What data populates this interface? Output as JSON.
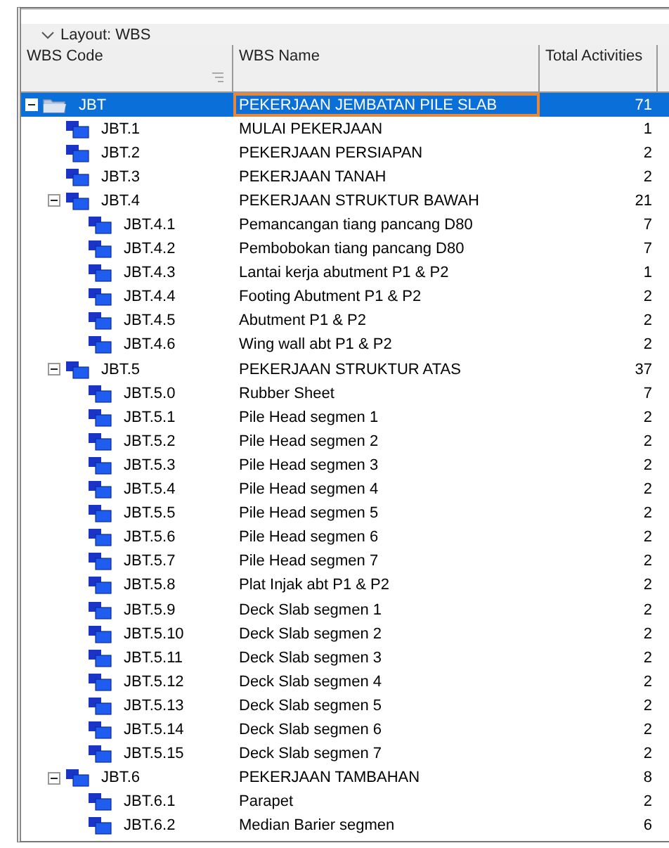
{
  "layout_bar": {
    "title": "Layout: WBS"
  },
  "table": {
    "columns": [
      "WBS Code",
      "WBS Name",
      "Total Activities"
    ],
    "rows": [
      {
        "code": "JBT",
        "name": "PEKERJAAN JEMBATAN PILE SLAB",
        "total": "71",
        "selected": true,
        "expanded": true,
        "children": [
          {
            "code": "JBT.1",
            "name": "MULAI PEKERJAAN",
            "total": "1",
            "selected": false
          },
          {
            "code": "JBT.2",
            "name": "PEKERJAAN PERSIAPAN",
            "total": "2",
            "selected": false
          },
          {
            "code": "JBT.3",
            "name": "PEKERJAAN TANAH",
            "total": "2",
            "selected": false
          },
          {
            "code": "JBT.4",
            "name": "PEKERJAAN STRUKTUR BAWAH",
            "total": "21",
            "selected": false,
            "expanded": true,
            "children": [
              {
                "code": "JBT.4.1",
                "name": "Pemancangan tiang pancang D80",
                "total": "7",
                "selected": false
              },
              {
                "code": "JBT.4.2",
                "name": "Pembobokan tiang pancang D80",
                "total": "7",
                "selected": false
              },
              {
                "code": "JBT.4.3",
                "name": "Lantai kerja abutment P1 & P2",
                "total": "1",
                "selected": false
              },
              {
                "code": "JBT.4.4",
                "name": "Footing Abutment P1 & P2",
                "total": "2",
                "selected": false
              },
              {
                "code": "JBT.4.5",
                "name": "Abutment P1 & P2",
                "total": "2",
                "selected": false
              },
              {
                "code": "JBT.4.6",
                "name": "Wing wall abt P1 & P2",
                "total": "2",
                "selected": false
              }
            ]
          },
          {
            "code": "JBT.5",
            "name": "PEKERJAAN STRUKTUR ATAS",
            "total": "37",
            "selected": false,
            "expanded": true,
            "children": [
              {
                "code": "JBT.5.0",
                "name": "Rubber Sheet",
                "total": "7",
                "selected": false
              },
              {
                "code": "JBT.5.1",
                "name": "Pile Head segmen 1",
                "total": "2",
                "selected": false
              },
              {
                "code": "JBT.5.2",
                "name": "Pile Head segmen 2",
                "total": "2",
                "selected": false
              },
              {
                "code": "JBT.5.3",
                "name": "Pile Head segmen 3",
                "total": "2",
                "selected": false
              },
              {
                "code": "JBT.5.4",
                "name": "Pile Head segmen 4",
                "total": "2",
                "selected": false
              },
              {
                "code": "JBT.5.5",
                "name": "Pile Head segmen 5",
                "total": "2",
                "selected": false
              },
              {
                "code": "JBT.5.6",
                "name": "Pile Head segmen 6",
                "total": "2",
                "selected": false
              },
              {
                "code": "JBT.5.7",
                "name": "Pile Head segmen 7",
                "total": "2",
                "selected": false
              },
              {
                "code": "JBT.5.8",
                "name": "Plat Injak abt P1 & P2",
                "total": "2",
                "selected": false
              },
              {
                "code": "JBT.5.9",
                "name": "Deck Slab segmen 1",
                "total": "2",
                "selected": false
              },
              {
                "code": "JBT.5.10",
                "name": "Deck Slab segmen 2",
                "total": "2",
                "selected": false
              },
              {
                "code": "JBT.5.11",
                "name": "Deck Slab segmen 3",
                "total": "2",
                "selected": false
              },
              {
                "code": "JBT.5.12",
                "name": "Deck Slab segmen 4",
                "total": "2",
                "selected": false
              },
              {
                "code": "JBT.5.13",
                "name": "Deck Slab segmen 5",
                "total": "2",
                "selected": false
              },
              {
                "code": "JBT.5.14",
                "name": "Deck Slab segmen 6",
                "total": "2",
                "selected": false
              },
              {
                "code": "JBT.5.15",
                "name": "Deck Slab segmen 7",
                "total": "2",
                "selected": false
              }
            ]
          },
          {
            "code": "JBT.6",
            "name": "PEKERJAAN TAMBAHAN",
            "total": "8",
            "selected": false,
            "expanded": true,
            "children": [
              {
                "code": "JBT.6.1",
                "name": "Parapet",
                "total": "2",
                "selected": false
              },
              {
                "code": "JBT.6.2",
                "name": "Median Barier segmen",
                "total": "6",
                "selected": false
              }
            ]
          }
        ]
      }
    ]
  }
}
